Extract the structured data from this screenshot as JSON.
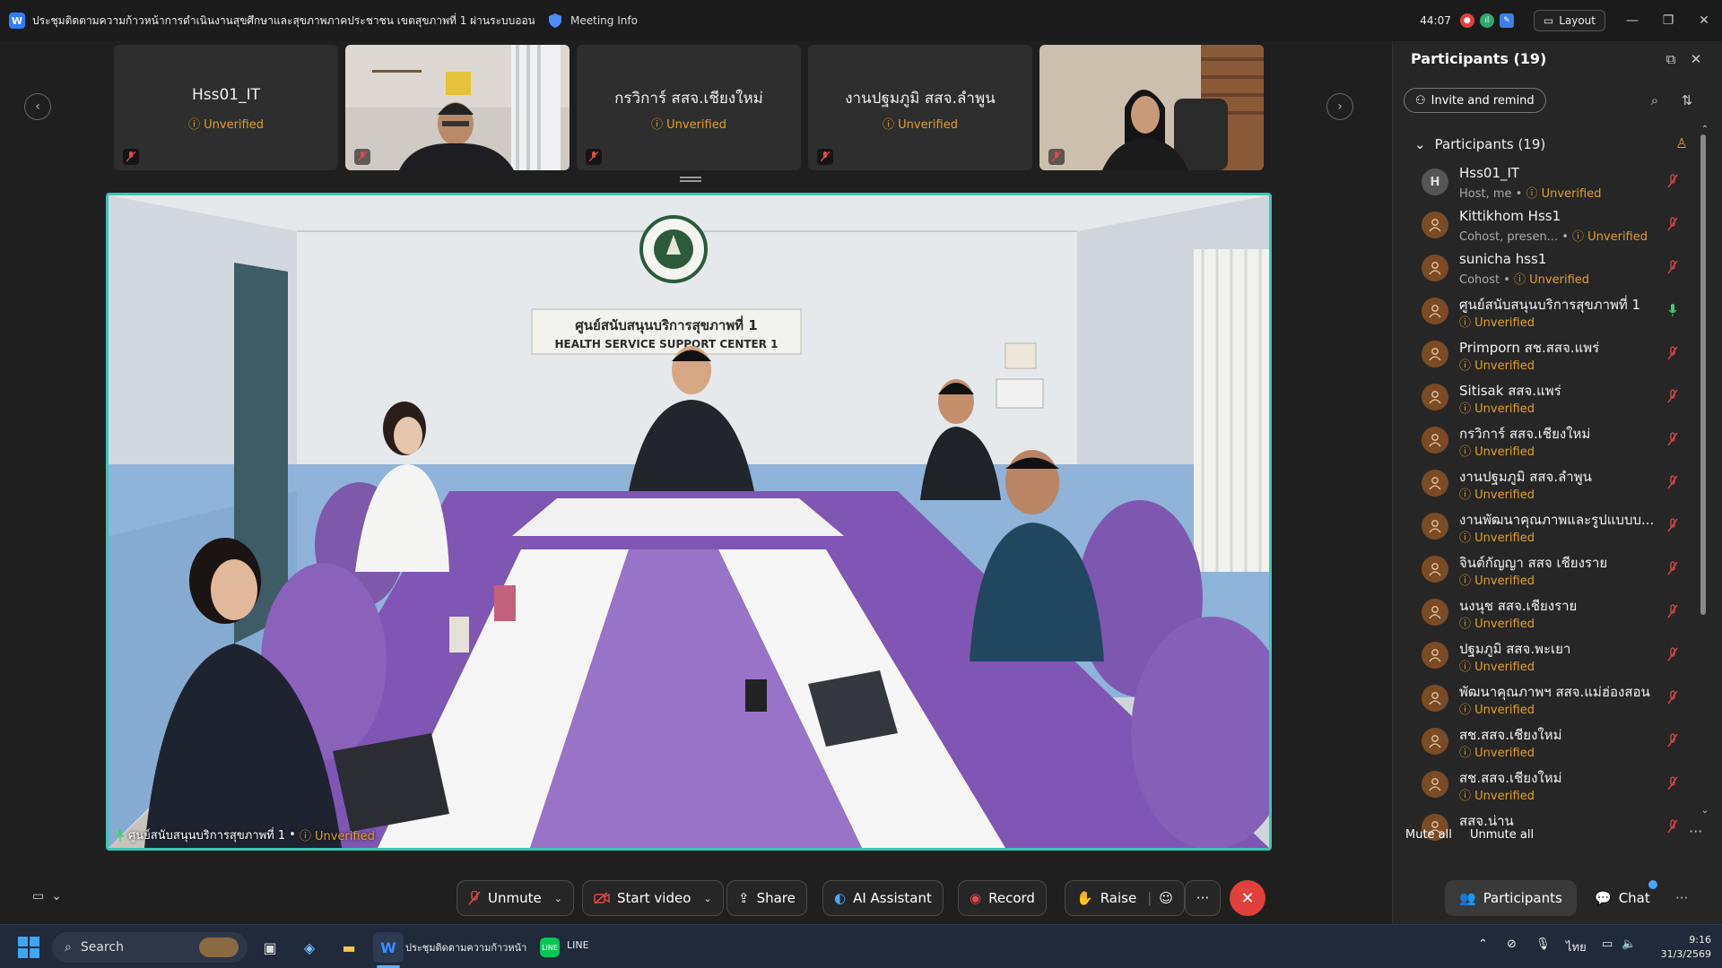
{
  "titlebar": {
    "meeting_title": "ประชุมติดตามความก้าวหน้าการดำเนินงานสุขศึกษาและสุขภาพภาคประชาชน เขตสุขภาพที่ 1 ผ่านระบบออนไลน์",
    "meeting_info": "Meeting Info",
    "timer": "44:07",
    "layout_label": "Layout"
  },
  "thumbnails": [
    {
      "name": "Hss01_IT",
      "status": "Unverified",
      "has_video": false
    },
    {
      "name": "",
      "status": "",
      "has_video": true
    },
    {
      "name": "กรวิการ์ สสจ.เชียงใหม่",
      "status": "Unverified",
      "has_video": false
    },
    {
      "name": "งานปฐมภูมิ สสจ.ลำพูน",
      "status": "Unverified",
      "has_video": false
    },
    {
      "name": "",
      "status": "",
      "has_video": true
    }
  ],
  "main_video": {
    "speaker": "ศูนย์สนับสนุนบริการสุขภาพที่ 1",
    "separator": "•",
    "status": "Unverified",
    "sign_th": "ศูนย์สนับสนุนบริการสุขภาพที่ 1",
    "sign_en": "HEALTH SERVICE SUPPORT CENTER 1"
  },
  "participants_panel": {
    "title": "Participants (19)",
    "invite_label": "Invite and remind",
    "list_header": "Participants (19)",
    "mute_all": "Mute all",
    "unmute_all": "Unmute all",
    "items": [
      {
        "name": "Hss01_IT",
        "role": "Host, me",
        "status": "Unverified",
        "avatar": "H",
        "mic": "muted"
      },
      {
        "name": "Kittikhom Hss1",
        "role": "Cohost, presen...",
        "status": "Unverified",
        "avatar": "",
        "mic": "muted"
      },
      {
        "name": "sunicha hss1",
        "role": "Cohost",
        "status": "Unverified",
        "avatar": "",
        "mic": "muted"
      },
      {
        "name": "ศูนย์สนับสนุนบริการสุขภาพที่ 1",
        "role": "",
        "status": "Unverified",
        "avatar": "",
        "mic": "active"
      },
      {
        "name": "Primporn สช.สสจ.แพร่",
        "role": "",
        "status": "Unverified",
        "avatar": "",
        "mic": "muted"
      },
      {
        "name": "Sitisak สสจ.แพร่",
        "role": "",
        "status": "Unverified",
        "avatar": "",
        "mic": "muted"
      },
      {
        "name": "กรวิการ์ สสจ.เชียงใหม่",
        "role": "",
        "status": "Unverified",
        "avatar": "",
        "mic": "muted"
      },
      {
        "name": "งานปฐมภูมิ สสจ.ลำพูน",
        "role": "",
        "status": "Unverified",
        "avatar": "",
        "mic": "muted"
      },
      {
        "name": "งานพัฒนาคุณภาพและรูปแบบบ...",
        "role": "",
        "status": "Unverified",
        "avatar": "",
        "mic": "muted"
      },
      {
        "name": "จินต์กัญญา สสจ เชียงราย",
        "role": "",
        "status": "Unverified",
        "avatar": "",
        "mic": "muted"
      },
      {
        "name": "นงนุช สสจ.เชียงราย",
        "role": "",
        "status": "Unverified",
        "avatar": "",
        "mic": "muted"
      },
      {
        "name": "ปฐมภูมิ สสจ.พะเยา",
        "role": "",
        "status": "Unverified",
        "avatar": "",
        "mic": "muted"
      },
      {
        "name": "พัฒนาคุณภาพฯ สสจ.แม่ฮ่องสอน",
        "role": "",
        "status": "Unverified",
        "avatar": "",
        "mic": "muted"
      },
      {
        "name": "สช.สสจ.เชียงใหม่",
        "role": "",
        "status": "Unverified",
        "avatar": "",
        "mic": "muted"
      },
      {
        "name": "สช.สสจ.เชียงใหม่",
        "role": "",
        "status": "Unverified",
        "avatar": "",
        "mic": "muted"
      },
      {
        "name": "สสจ.น่าน",
        "role": "",
        "status": "",
        "avatar": "",
        "mic": "muted"
      }
    ]
  },
  "toolbar": {
    "unmute": "Unmute",
    "start_video": "Start video",
    "share": "Share",
    "ai_assistant": "AI Assistant",
    "record": "Record",
    "raise": "Raise",
    "more": "···",
    "participants": "Participants",
    "chat": "Chat"
  },
  "taskbar": {
    "search": "Search",
    "webex_label": "ประชุมติดตามความก้าวหน้า",
    "line_label": "LINE",
    "language": "ไทย",
    "time": "9:16",
    "date": "31/3/2569"
  },
  "colors": {
    "accent_teal": "#3ac6b2",
    "unverified": "#e5a028",
    "end_red": "#e0413a",
    "muted_red": "#e04848",
    "active_green": "#3fcf6b"
  }
}
